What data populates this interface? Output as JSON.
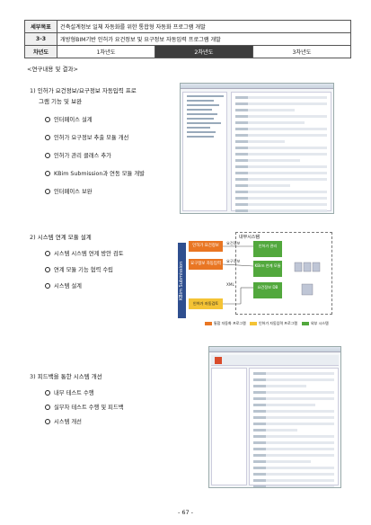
{
  "header": {
    "row1_key": "세부목표",
    "row1_value": "건축설계정보 일체 자동화를 위한 통합형 자동화 프로그램 개발",
    "row2_key": "3-3",
    "row2_value": "개방형BIM기반 인허가 요건정보 및 요구정보 자동입력 프로그램 개발",
    "row3_key": "차년도",
    "years": [
      "1차년도",
      "2차년도",
      "3차년도"
    ],
    "active_year": "2차년도"
  },
  "section_title": "<연구내용 및 결과>",
  "items": [
    {
      "title_line1": "1) 인허가 요건정보/요구정보 자동입력 프로",
      "title_line2": "그램 기능 및 보완",
      "bullets": [
        "인터페이스 설계",
        "인허가 요구정보 추출 모듈 개선",
        "인허가 관리 클래스 추가",
        "KBim Submission과 연동 모듈 개발",
        "인터페이스 보완"
      ]
    },
    {
      "title_line1": "2) 시스템 연계 모듈 설계",
      "bullets": [
        "시스템 시스템 연계 방안 검토",
        "연계 모듈 기능 협력 수립",
        "시스템 설계"
      ]
    },
    {
      "title_line1": "3) 피드백을 통한 시스템 개선",
      "bullets": [
        "내부 테스트 수행",
        "실무자 테스트 수행 및 피드백",
        "시스템 개선"
      ]
    }
  ],
  "diagram": {
    "vertical_label": "KBim Submission",
    "orange_boxes": [
      "인허가 요건정보",
      "요구정보 자동입력"
    ],
    "green_boxes": [
      "인허가 관리",
      "KBim 연계 모듈",
      "요건정보 DB"
    ],
    "yellow_box": "인허가 자동검토",
    "flow_labels": [
      "요건정보",
      "요구정보",
      "XML"
    ],
    "dash_title": "내부시스템",
    "legend": [
      {
        "label": "통합 자동화 프로그램",
        "color": "#e97623"
      },
      {
        "label": "인허가 자동입력 프로그램",
        "color": "#f4c335"
      },
      {
        "label": "외부 시스템",
        "color": "#52a83d"
      }
    ]
  },
  "page_number": "- 67 -"
}
